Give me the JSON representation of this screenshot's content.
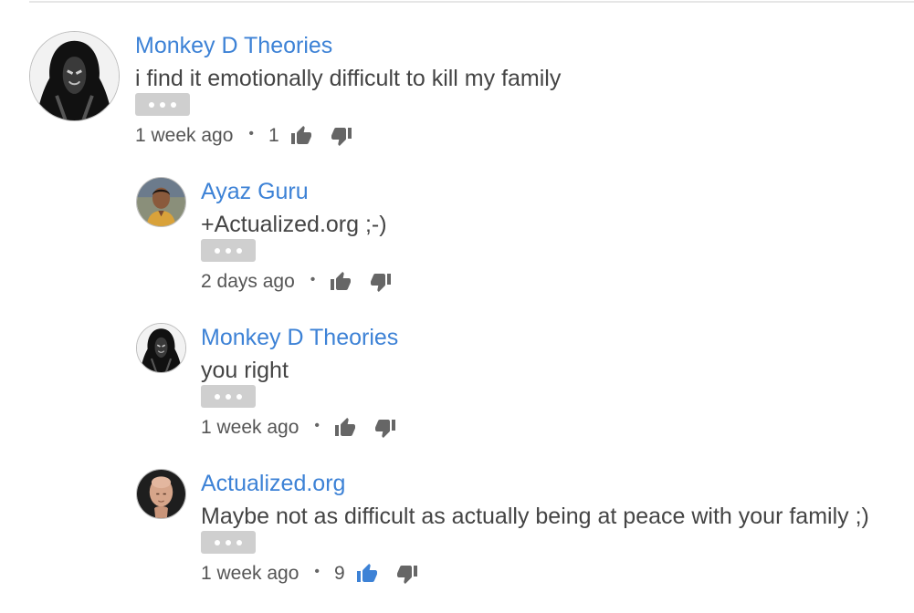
{
  "comments": [
    {
      "author": "Monkey D Theories",
      "text": "i find it emotionally difficult to kill my family",
      "time": "1 week ago",
      "separator": "•",
      "likes": "1",
      "liked": false,
      "avatar_icon": "hooded-figure-avatar"
    },
    {
      "author": "Ayaz Guru",
      "text": "+Actualized.org ;-)",
      "time": "2 days ago",
      "separator": "•",
      "likes": "",
      "liked": false,
      "avatar_icon": "person-photo-avatar"
    },
    {
      "author": "Monkey D Theories",
      "text": "you right",
      "time": "1 week ago",
      "separator": "•",
      "likes": "",
      "liked": false,
      "avatar_icon": "hooded-figure-avatar"
    },
    {
      "author": "Actualized.org",
      "text": "Maybe not as difficult as actually being at peace with your family ;)",
      "time": "1 week ago",
      "separator": "•",
      "likes": "9",
      "liked": true,
      "avatar_icon": "bald-man-avatar"
    }
  ],
  "colors": {
    "author_link": "#3d82d6",
    "thumb_default": "#666666",
    "thumb_active": "#3d82d6",
    "more_button": "#cfcfcf"
  }
}
